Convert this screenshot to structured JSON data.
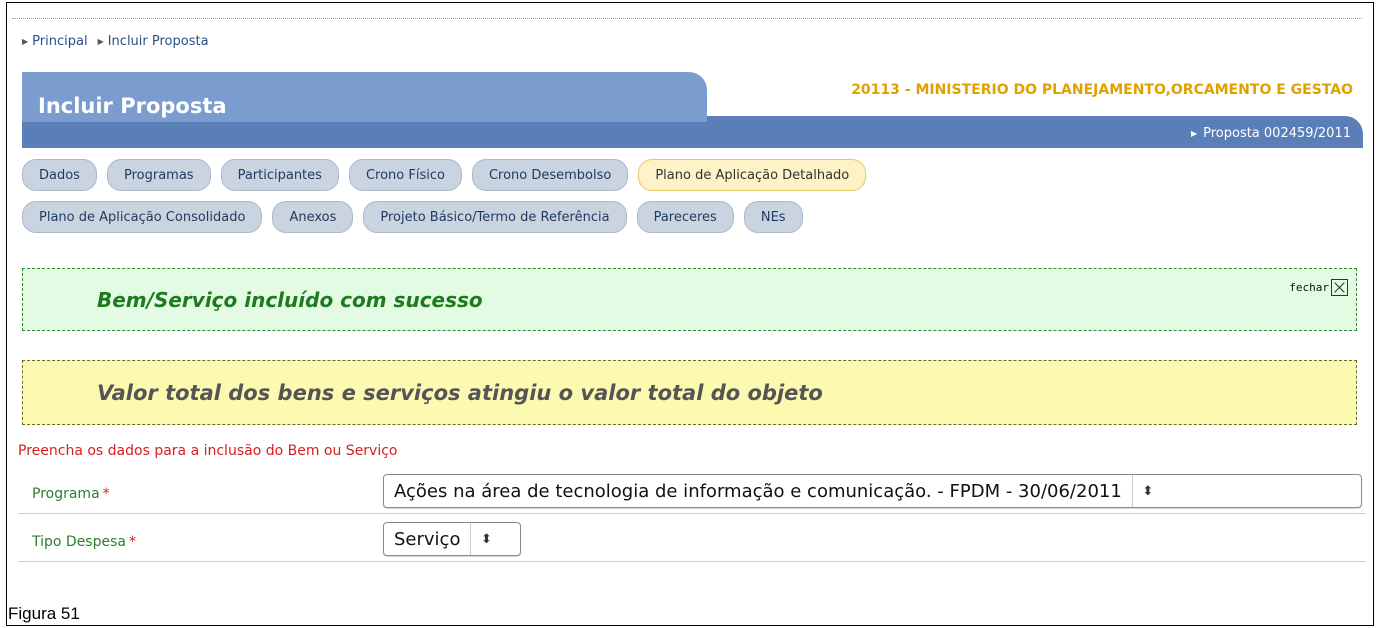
{
  "breadcrumb": {
    "items": [
      "Principal",
      "Incluir Proposta"
    ]
  },
  "header": {
    "title": "Incluir Proposta",
    "organization": "20113 - MINISTERIO DO PLANEJAMENTO,ORCAMENTO E GESTAO",
    "proposal": "Proposta 002459/2011"
  },
  "tabs": {
    "row1": [
      "Dados",
      "Programas",
      "Participantes",
      "Crono Físico",
      "Crono Desembolso",
      "Plano de Aplicação Detalhado"
    ],
    "row2": [
      "Plano de Aplicação Consolidado",
      "Anexos",
      "Projeto Básico/Termo de Referência",
      "Pareceres",
      "NEs"
    ],
    "active": "Plano de Aplicação Detalhado"
  },
  "messages": {
    "success": "Bem/Serviço incluído com sucesso",
    "close_label": "fechar",
    "warning": "Valor total dos bens e serviços atingiu o valor total do objeto"
  },
  "form": {
    "instruction": "Preencha os dados para a inclusão do Bem ou Serviço",
    "programa_label": "Programa",
    "programa_value": "Ações na área de tecnologia de informação e comunicação. - FPDM - 30/06/2011",
    "tipo_label": "Tipo Despesa",
    "tipo_value": "Serviço",
    "required_mark": "*"
  },
  "caption": "Figura 51",
  "colors": {
    "title_tab": "#7b9ccf",
    "title_band": "#5a7fb8",
    "organization": "#e0a100",
    "success_bg": "#e2fbe2",
    "success_text": "#1f7a1f",
    "warning_bg": "#fbfab0",
    "instruction": "#d62020",
    "label": "#2e7d2e"
  }
}
